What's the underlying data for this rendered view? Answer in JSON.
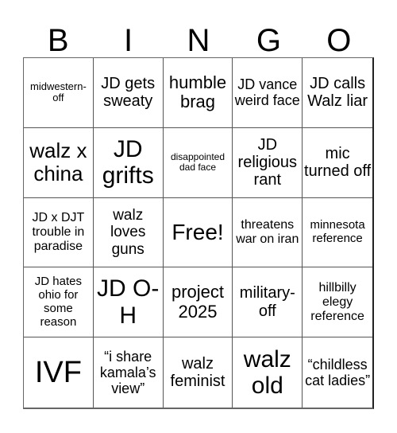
{
  "header": {
    "letters": [
      "B",
      "I",
      "N",
      "G",
      "O"
    ]
  },
  "card": {
    "cells": [
      "midwestern-off",
      "JD gets sweaty",
      "humble brag",
      "JD vance weird face",
      "JD calls Walz liar",
      "walz x china",
      "JD grifts",
      "disappointed dad face",
      "JD religious rant",
      "mic turned off",
      "JD x DJT trouble in paradise",
      "walz loves guns",
      "Free!",
      "threatens war on iran",
      "minnesota reference",
      "JD hates ohio for some reason",
      "JD O-H",
      "project 2025",
      "military-off",
      "hillbilly elegy reference",
      "IVF",
      "“i share kamala’s view”",
      "walz feminist",
      "walz old",
      "“childless cat ladies”"
    ],
    "free_space_index": 12
  }
}
